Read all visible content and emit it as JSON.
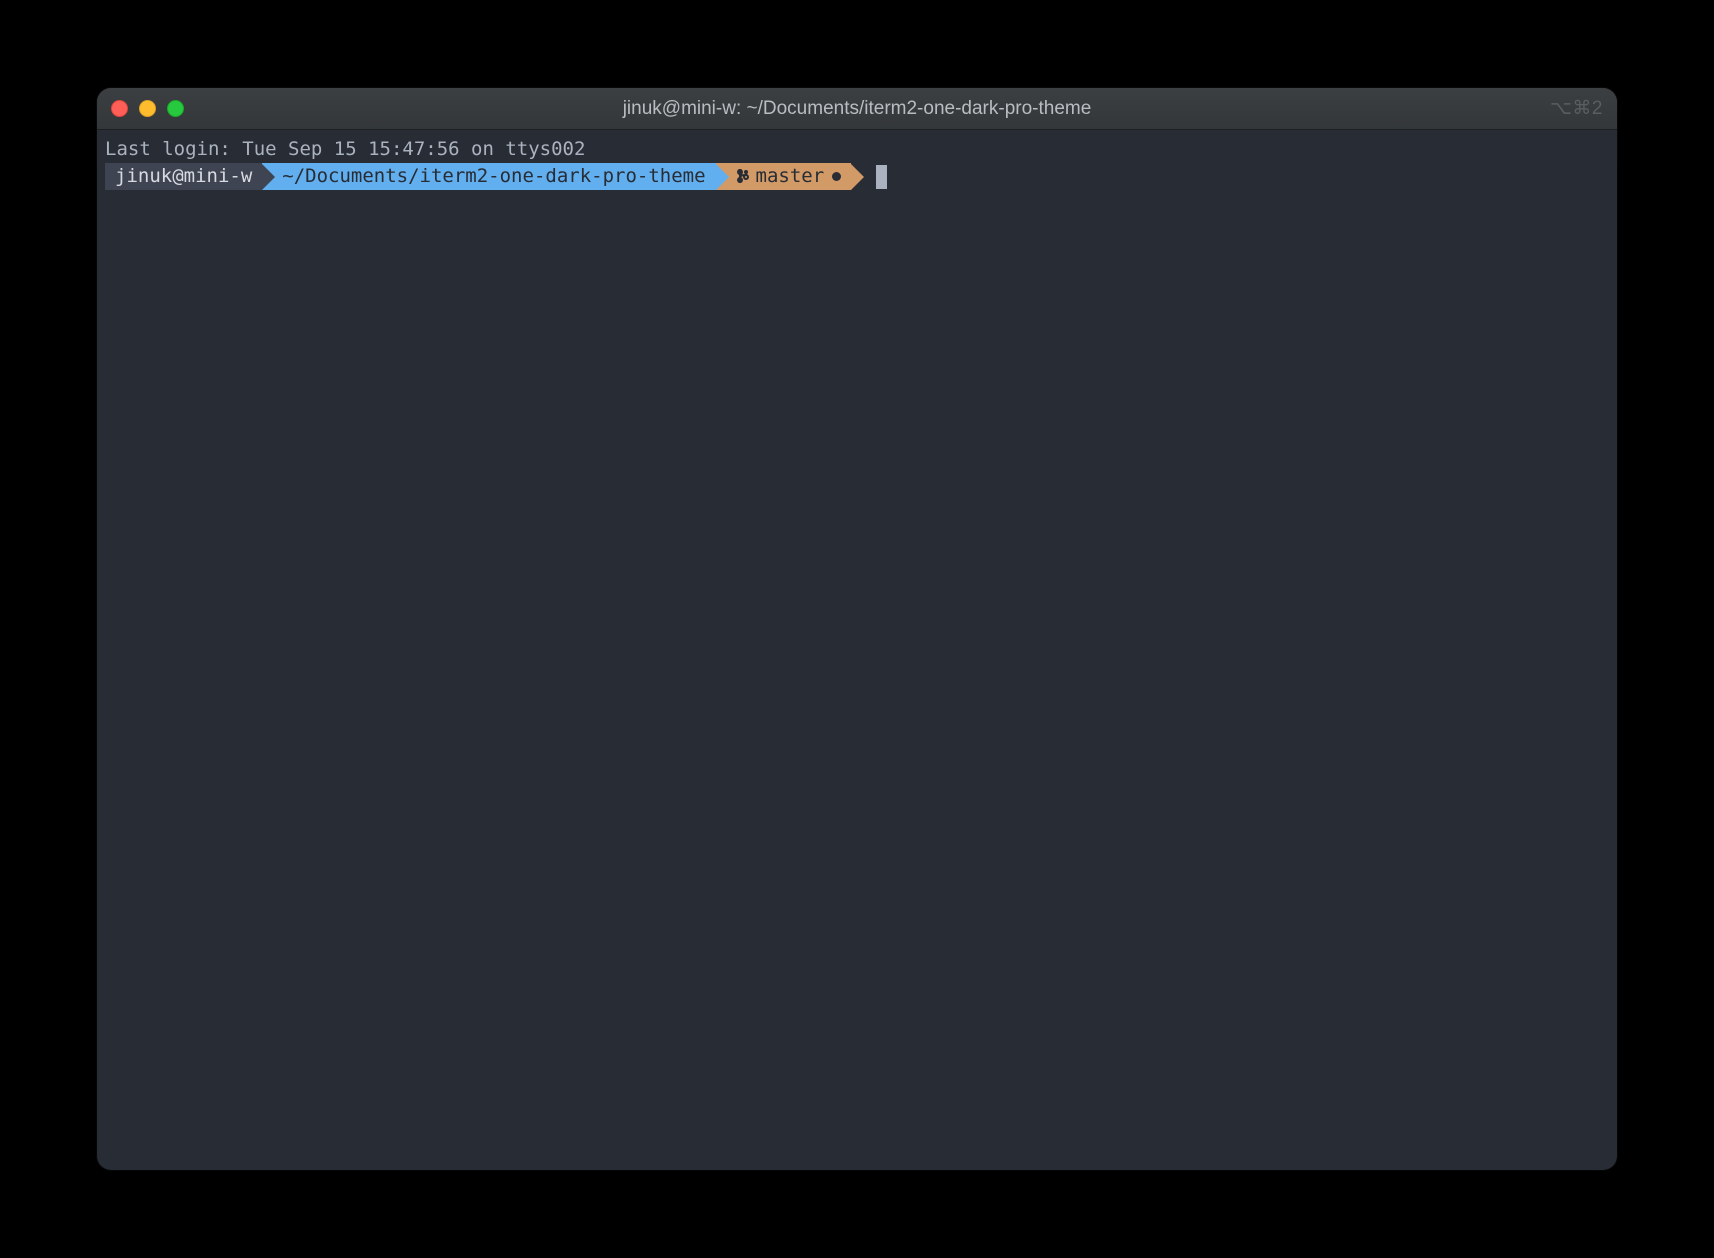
{
  "titlebar": {
    "window_title": "jinuk@mini-w: ~/Documents/iterm2-one-dark-pro-theme",
    "right_indicator": "⌥⌘2"
  },
  "terminal": {
    "last_login": "Last login: Tue Sep 15 15:47:56 on ttys002",
    "prompt": {
      "user_host": "jinuk@mini-w",
      "path": "~/Documents/iterm2-one-dark-pro-theme",
      "git_branch": "master",
      "git_icon": "git-branch-icon",
      "dirty_indicator": "●"
    }
  },
  "colors": {
    "window_bg": "#282c34",
    "text": "#abb2bf",
    "host_bg": "#3e4452",
    "path_bg": "#61afef",
    "git_bg": "#d19a66",
    "close": "#ff5f56",
    "min": "#ffbd2e",
    "zoom": "#27c93f"
  }
}
